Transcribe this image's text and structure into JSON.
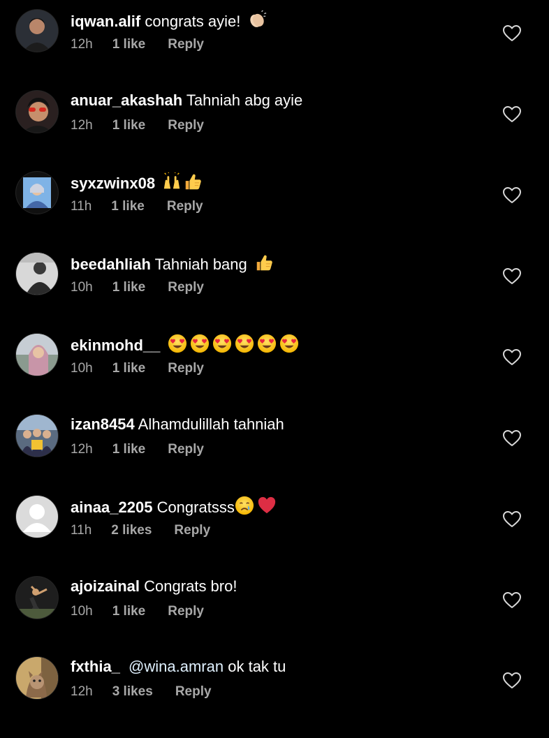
{
  "colors": {
    "background": "#000000",
    "text_primary": "#ffffff",
    "text_secondary": "#a8a8a8",
    "heart_outline": "#d8d8d8"
  },
  "comments": [
    {
      "username": "iqwan.alif",
      "text": "congrats ayie!",
      "emoji": [
        "clapping-hands"
      ],
      "time": "12h",
      "likes": "1 like",
      "reply": "Reply",
      "avatar": "man-photo-dark"
    },
    {
      "username": "anuar_akashah",
      "text": "Tahniah abg ayie",
      "emoji": [],
      "time": "12h",
      "likes": "1 like",
      "reply": "Reply",
      "avatar": "man-red-sunglasses"
    },
    {
      "username": "syxzwinx08",
      "text": "",
      "emoji": [
        "raising-hands",
        "thumbs-up"
      ],
      "time": "11h",
      "likes": "1 like",
      "reply": "Reply",
      "avatar": "person-blue-photo"
    },
    {
      "username": "beedahliah",
      "text": "Tahniah bang",
      "emoji": [
        "thumbs-up"
      ],
      "time": "10h",
      "likes": "1 like",
      "reply": "Reply",
      "avatar": "man-grey-photo"
    },
    {
      "username": "ekinmohd__",
      "text": "",
      "emoji": [
        "heart-eyes",
        "heart-eyes",
        "heart-eyes",
        "heart-eyes",
        "heart-eyes",
        "heart-eyes"
      ],
      "time": "10h",
      "likes": "1 like",
      "reply": "Reply",
      "avatar": "woman-hijab-photo"
    },
    {
      "username": "izan8454",
      "text": "Alhamdulillah tahniah",
      "emoji": [],
      "time": "12h",
      "likes": "1 like",
      "reply": "Reply",
      "avatar": "group-photo"
    },
    {
      "username": "ainaa_2205",
      "text": "Congratsss",
      "emoji": [
        "crying-face",
        "red-heart"
      ],
      "time": "11h",
      "likes": "2 likes",
      "reply": "Reply",
      "avatar": "default-avatar"
    },
    {
      "username": "ajoizainal",
      "text": "Congrats bro!",
      "emoji": [],
      "time": "10h",
      "likes": "1 like",
      "reply": "Reply",
      "avatar": "person-pose-photo"
    },
    {
      "username": "fxthia_",
      "mention": "@wina.amran",
      "text": "ok tak tu",
      "emoji": [],
      "time": "12h",
      "likes": "3 likes",
      "reply": "Reply",
      "avatar": "cat-photo"
    }
  ]
}
